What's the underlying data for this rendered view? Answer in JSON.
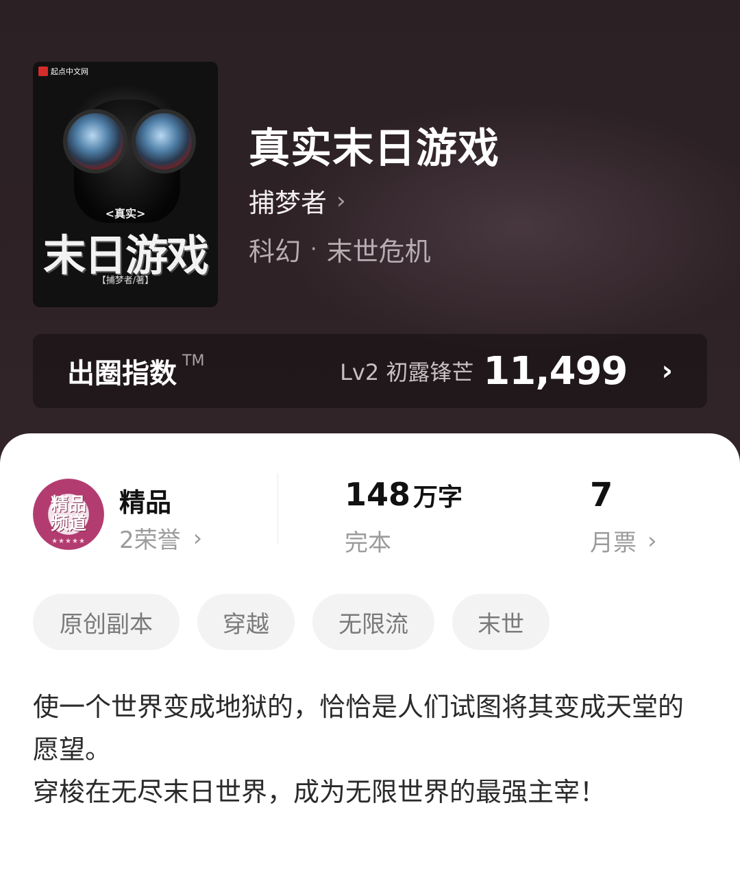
{
  "book": {
    "title": "真实末日游戏",
    "author": "捕梦者",
    "genre_main": "科幻",
    "genre_sep": "·",
    "genre_sub": "末世危机",
    "chevron": "›"
  },
  "cover": {
    "brand": "起点中文网",
    "small_title": "<真实>",
    "art_title": "末日游戏",
    "author_line": "【捕梦者/著】"
  },
  "index": {
    "label": "出圈指数",
    "tm": "TM",
    "level": "Lv2 初露锋芒",
    "score": "11,499",
    "chevron": "›"
  },
  "stats": {
    "quality": {
      "title": "精品",
      "sub": "2荣誉",
      "badge_text_line1": "精品",
      "badge_text_line2": "频道",
      "badge_stars": "★★★★★"
    },
    "words": {
      "number": "148",
      "unit": "万字",
      "status": "完本"
    },
    "votes": {
      "number": "7",
      "label": "月票"
    },
    "chevron": "›"
  },
  "tags": [
    "原创副本",
    "穿越",
    "无限流",
    "末世"
  ],
  "description": {
    "line1": "使一个世界变成地狱的，恰恰是人们试图将其变成天堂的愿望。",
    "line2": "穿梭在无尽末日世界，成为无限世界的最强主宰！"
  }
}
